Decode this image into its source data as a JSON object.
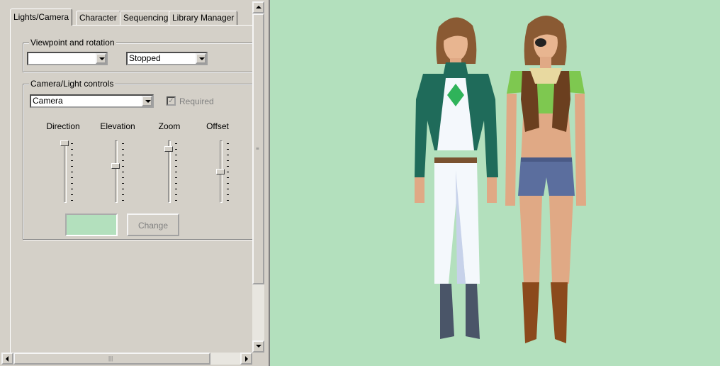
{
  "tabs": [
    {
      "label": "Lights/Camera",
      "active": true
    },
    {
      "label": "Character",
      "active": false
    },
    {
      "label": "Sequencing",
      "active": false
    },
    {
      "label": "Library Manager",
      "active": false
    }
  ],
  "viewpoint_group": {
    "legend": "Viewpoint and rotation",
    "viewpoint_value": "",
    "rotation_value": "Stopped"
  },
  "camera_group": {
    "legend": "Camera/Light controls",
    "target_value": "Camera",
    "required_label": "Required",
    "required_checked": true,
    "required_enabled": false
  },
  "sliders": [
    {
      "label": "Direction",
      "value": 0.0
    },
    {
      "label": "Elevation",
      "value": 0.4
    },
    {
      "label": "Zoom",
      "value": 0.1
    },
    {
      "label": "Offset",
      "value": 0.5
    }
  ],
  "color_swatch": "#b3e0bd",
  "change_button_label": "Change",
  "scroll_grip": "≡",
  "h_scroll_grip": "|||",
  "viewport_bg": "#b3e0bd"
}
